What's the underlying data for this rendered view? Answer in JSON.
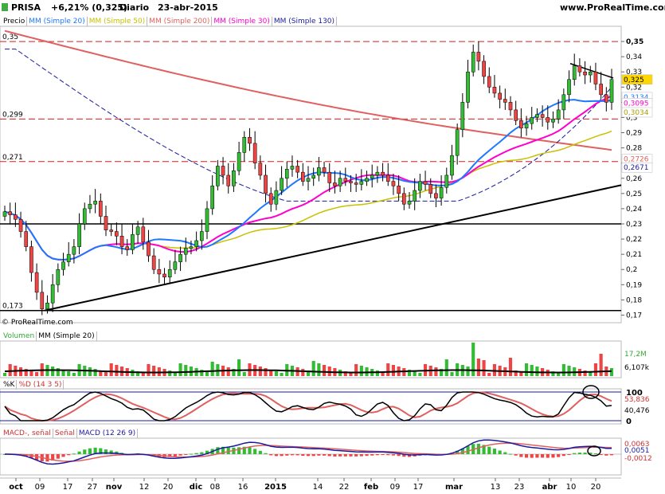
{
  "header": {
    "symbol": "PRISA",
    "change": "+6,21% (0,325)",
    "period": "Diario",
    "date": "23-abr-2015",
    "site": "www.ProRealTime.com"
  },
  "copyright": "© ProRealTime.com",
  "main": {
    "legend": [
      {
        "label": "Precio",
        "color": "#000000"
      },
      {
        "label": "MM (Simple 20)",
        "color": "#1e78ff"
      },
      {
        "label": "MM (Simple 50)",
        "color": "#c8c000"
      },
      {
        "label": "MM (Simple 200)",
        "color": "#e06060"
      },
      {
        "label": "MM (Simple 30)",
        "color": "#ff00cc"
      },
      {
        "label": "MM (Simple 130)",
        "color": "#1a1aa0"
      }
    ],
    "ylim": [
      0.165,
      0.36
    ],
    "yticks": [
      "0,35",
      "0,34",
      "0,33",
      "0,32",
      "0,31",
      "0,3",
      "0,29",
      "0,28",
      "0,27",
      "0,26",
      "0,25",
      "0,24",
      "0,23",
      "0,22",
      "0,21",
      "0,2",
      "0,19",
      "0,18",
      "0,17"
    ],
    "level_labels": [
      {
        "text": "0,35",
        "value": 0.35
      },
      {
        "text": "0,299",
        "value": 0.299
      },
      {
        "text": "0,271",
        "value": 0.271
      },
      {
        "text": "0,173",
        "value": 0.173
      }
    ],
    "value_tags": [
      {
        "text": "0,325",
        "value": 0.325,
        "bg": "#ffd700",
        "fg": "#000000"
      },
      {
        "text": "0,3134",
        "value": 0.3134,
        "bg": "#ffffff",
        "fg": "#1e78ff"
      },
      {
        "text": "0,3095",
        "value": 0.3095,
        "bg": "#ffffff",
        "fg": "#ff00cc"
      },
      {
        "text": "0,3034",
        "value": 0.3034,
        "bg": "#ffffff",
        "fg": "#a8a000"
      },
      {
        "text": "0,2726",
        "value": 0.2726,
        "bg": "#ffffff",
        "fg": "#e06060"
      },
      {
        "text": "0,2671",
        "value": 0.2671,
        "bg": "#ffffff",
        "fg": "#1a1aa0"
      }
    ]
  },
  "volume": {
    "legend": [
      "Volumen",
      "MM (Simple 20)"
    ],
    "tags": [
      {
        "text": "17,2M",
        "color": "#33aa33"
      },
      {
        "text": "6,107k",
        "color": "#000000"
      }
    ]
  },
  "stoch": {
    "legend": [
      "%K",
      "%D (14 3 5)"
    ],
    "yticks": [
      "100",
      "0"
    ],
    "tags": [
      {
        "text": "53,836",
        "color": "#d03030"
      },
      {
        "text": "40,476",
        "color": "#000000"
      }
    ]
  },
  "macd": {
    "legend": [
      "MACD-, señal",
      "Señal",
      "MACD (12 26 9)"
    ],
    "tags": [
      {
        "text": "0,0063",
        "color": "#d03030"
      },
      {
        "text": "0,0051",
        "color": "#1a1aa0"
      },
      {
        "text": "-0,0012",
        "color": "#d03030"
      }
    ]
  },
  "xaxis": [
    "oct",
    "09",
    "17",
    "27",
    "nov",
    "12",
    "20",
    "dic",
    "08",
    "16",
    "2015",
    "14",
    "22",
    "feb",
    "09",
    "17",
    "mar",
    "13",
    "23",
    "abr",
    "10",
    "20"
  ],
  "chart_data": {
    "type": "candlestick",
    "title": "PRISA Diario 23-abr-2015",
    "ylim": [
      0.165,
      0.36
    ],
    "close_approx": [
      0.238,
      0.236,
      0.233,
      0.225,
      0.215,
      0.198,
      0.185,
      0.174,
      0.178,
      0.19,
      0.2,
      0.205,
      0.21,
      0.215,
      0.23,
      0.24,
      0.243,
      0.245,
      0.235,
      0.226,
      0.225,
      0.222,
      0.215,
      0.213,
      0.223,
      0.228,
      0.218,
      0.209,
      0.2,
      0.197,
      0.195,
      0.2,
      0.205,
      0.21,
      0.214,
      0.215,
      0.219,
      0.225,
      0.24,
      0.255,
      0.268,
      0.262,
      0.255,
      0.265,
      0.277,
      0.287,
      0.283,
      0.27,
      0.262,
      0.25,
      0.243,
      0.252,
      0.26,
      0.266,
      0.268,
      0.264,
      0.258,
      0.26,
      0.262,
      0.267,
      0.264,
      0.257,
      0.255,
      0.26,
      0.258,
      0.257,
      0.256,
      0.258,
      0.26,
      0.262,
      0.264,
      0.262,
      0.258,
      0.255,
      0.25,
      0.243,
      0.245,
      0.252,
      0.258,
      0.256,
      0.25,
      0.247,
      0.254,
      0.262,
      0.275,
      0.292,
      0.31,
      0.33,
      0.343,
      0.337,
      0.327,
      0.32,
      0.316,
      0.312,
      0.31,
      0.305,
      0.298,
      0.293,
      0.296,
      0.3,
      0.302,
      0.3,
      0.297,
      0.299,
      0.305,
      0.315,
      0.325,
      0.334,
      0.33,
      0.328,
      0.33,
      0.322,
      0.315,
      0.31,
      0.325
    ],
    "sma_trend_note": "MM 20 ends 0,3134; MM 50 ends 0,3034; MM 200 ends 0,2726; MM 30 ends 0,3095; MM 130 ends 0,2671",
    "horizontal_levels": [
      0.35,
      0.299,
      0.271,
      0.23,
      0.173
    ],
    "trendline": {
      "from": [
        0.173,
        "oct"
      ],
      "to": [
        0.255,
        "abr 20"
      ]
    }
  }
}
